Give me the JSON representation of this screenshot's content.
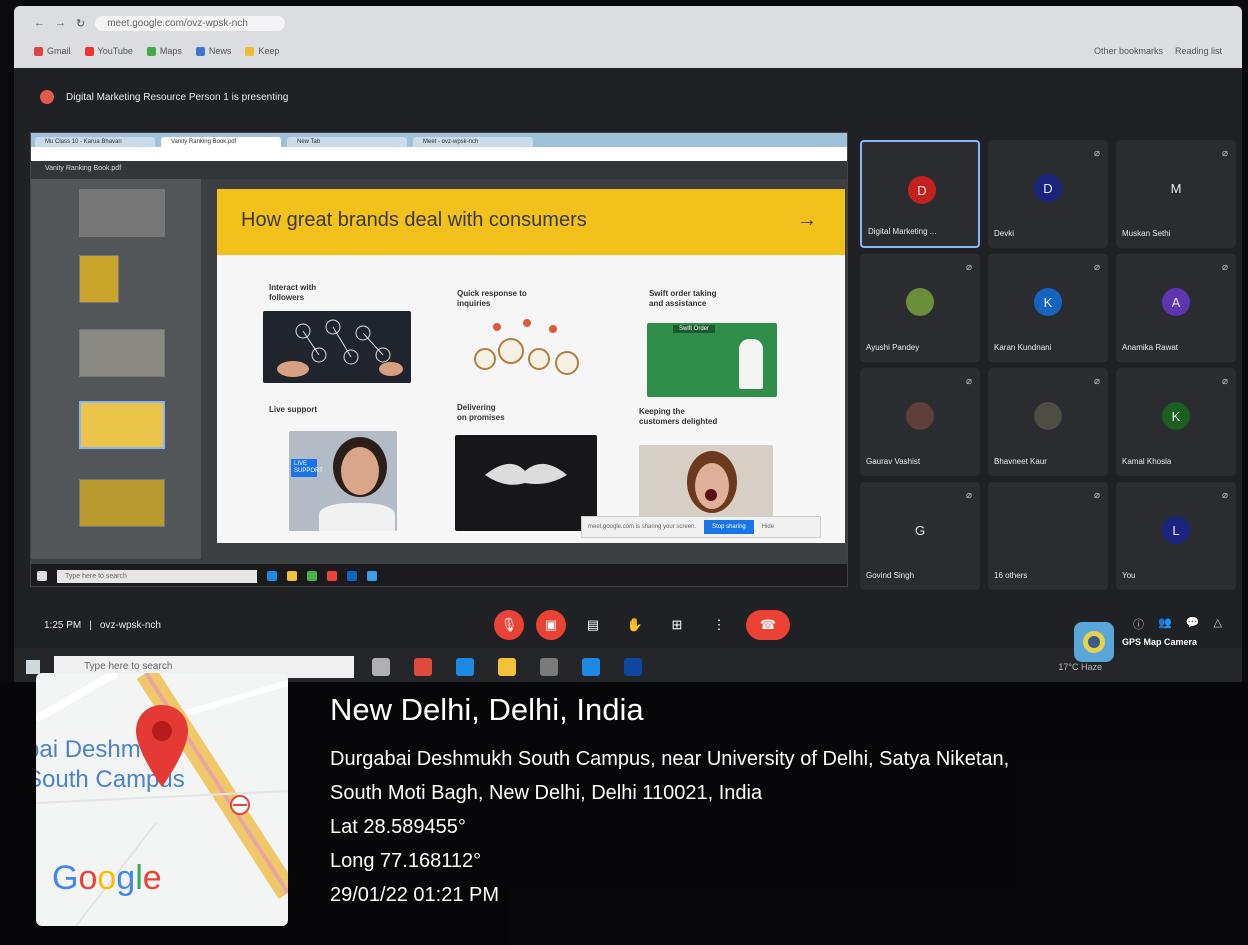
{
  "browser": {
    "url": "meet.google.com/ovz-wpsk-nch",
    "bookmarks": [
      "Gmail",
      "YouTube",
      "Maps",
      "",
      "News",
      "Gmail",
      "Keep"
    ],
    "bookmarks_right": [
      "Other bookmarks",
      "Reading list"
    ]
  },
  "meet": {
    "presenting_text": "Digital Marketing Resource Person 1 is presenting",
    "meeting_time": "1:25 PM",
    "meeting_code": "ovz-wpsk-nch",
    "participants": [
      {
        "name": "Digital Marketing ...",
        "initial": "D",
        "color": "#c5221f",
        "speaking": true
      },
      {
        "name": "Devki",
        "initial": "D",
        "color": "#1a237e"
      },
      {
        "name": "Muskan Sethi",
        "initial": "M",
        "color": "#2b2c30"
      },
      {
        "name": "Ayushi Pandey",
        "initial": "",
        "color": "#6b8e3a"
      },
      {
        "name": "Karan Kundnani",
        "initial": "K",
        "color": "#1565c0"
      },
      {
        "name": "Anamika Rawat",
        "initial": "A",
        "color": "#5e35b1"
      },
      {
        "name": "Gaurav Vashist",
        "initial": "",
        "color": "#5d4037"
      },
      {
        "name": "Bhavneet Kaur",
        "initial": "",
        "color": "#4e4e44"
      },
      {
        "name": "Kamal Khosla",
        "initial": "K",
        "color": "#1b5e20"
      },
      {
        "name": "Govind Singh",
        "initial": "G",
        "color": "#2b2c30"
      },
      {
        "name": "16 others",
        "initial": "",
        "color": "#2b2c30"
      },
      {
        "name": "You",
        "initial": "L",
        "color": "#1a237e"
      }
    ]
  },
  "share": {
    "tabs": [
      "Mu Class 10 - Karua Bhavan",
      "Vanity Ranking Book.pdf",
      "New Tab",
      "Meet - ovz-wpsk-nch"
    ],
    "pdf_filename": "Vanity Ranking Book.pdf",
    "slide": {
      "title": "How great brands deal with consumers",
      "arrow": "→",
      "cells": [
        "Interact with\nfollowers",
        "Quick response to\ninquiries",
        "Swift order taking\nand assistance",
        "Live support",
        "Delivering\non promises",
        "Keeping the\ncustomers delighted"
      ],
      "swift_order_label": "Swift Order",
      "live_support_label": "LIVE SUPPORT"
    },
    "cookie_notice": "meet.google.com is sharing your screen.",
    "cookie_button": "Stop sharing",
    "cookie_hide": "Hide",
    "taskbar_search": "Type here to search"
  },
  "taskbar": {
    "search_placeholder": "Type here to search",
    "weather": "17°C Haze"
  },
  "gps": {
    "app_label": "GPS Map Camera",
    "map_place_label": "bai Deshmukh\nSouth Campus",
    "map_logo": "Google",
    "city": "New Delhi, Delhi, India",
    "address_line1": "Durgabai Deshmukh South Campus, near University of Delhi, Satya Niketan,",
    "address_line2": "South Moti Bagh, New Delhi, Delhi 110021, India",
    "lat": "Lat 28.589455°",
    "long": "Long 77.168112°",
    "datetime": "29/01/22 01:21 PM"
  }
}
